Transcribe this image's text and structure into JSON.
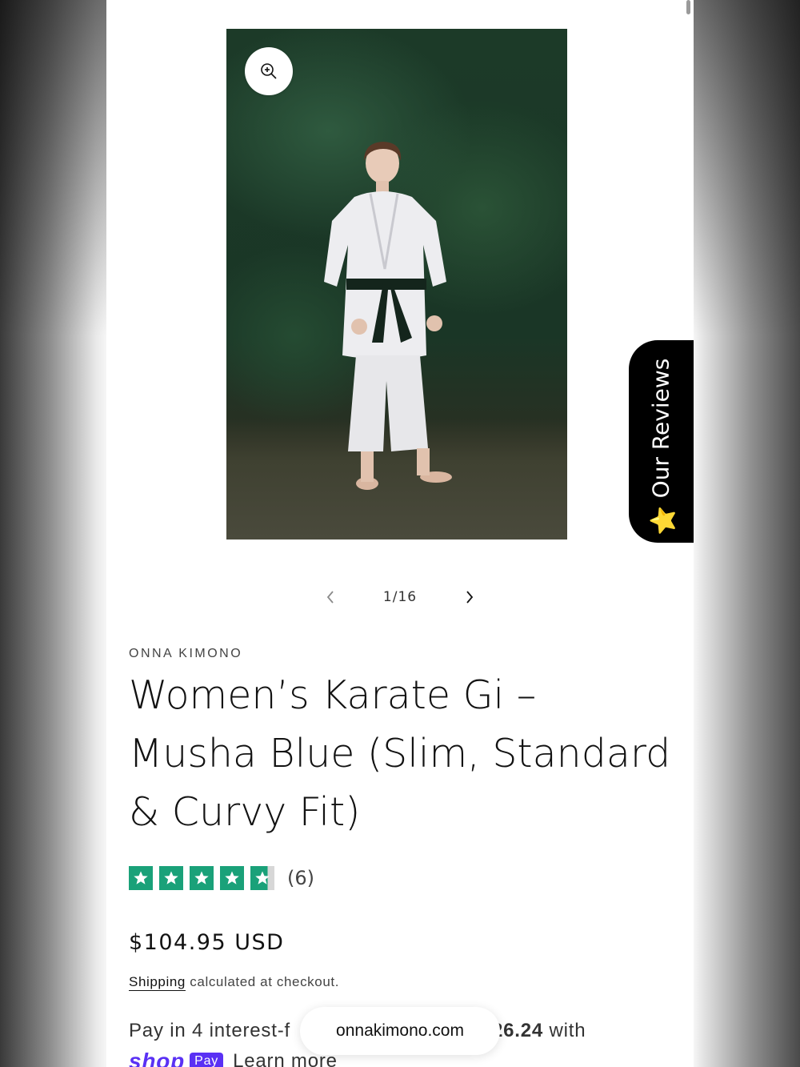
{
  "gallery": {
    "counter": "1/16",
    "zoom_icon": "zoom-in-icon",
    "prev_icon": "chevron-left-icon",
    "next_icon": "chevron-right-icon"
  },
  "reviews_tab": {
    "label": "Our Reviews",
    "star": "⭐"
  },
  "product": {
    "vendor": "ONNA KIMONO",
    "title": "Women’s Karate Gi – Musha Blue (Slim, Standard & Curvy Fit)",
    "rating": {
      "stars": 4.5,
      "max": 5,
      "count_label": "(6)"
    },
    "price": "$104.95 USD",
    "shipping_link": "Shipping",
    "shipping_text": " calculated at checkout.",
    "installments": {
      "prefix": "Pay in 4 interest-f",
      "amount": "26.24",
      "suffix": " with"
    },
    "shoppay": {
      "shop": "shop",
      "pay": "Pay",
      "learn_more": "Learn more"
    }
  },
  "browser": {
    "url": "onnakimono.com"
  },
  "colors": {
    "star_green": "#1aa179",
    "shop_pay_purple": "#5a31f4",
    "reviews_tab_bg": "#000000"
  }
}
